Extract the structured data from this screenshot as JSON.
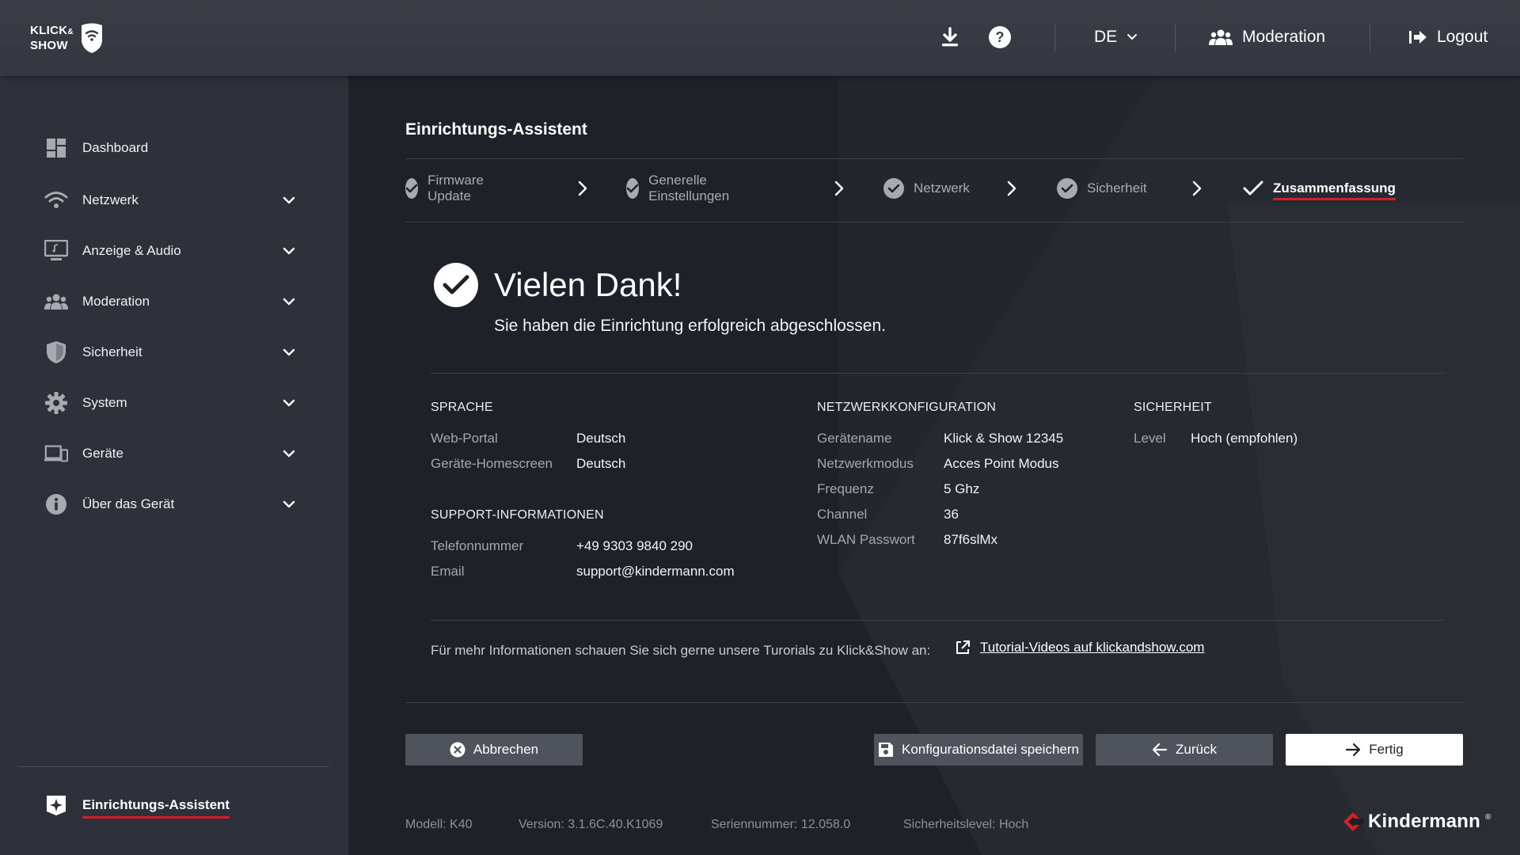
{
  "header": {
    "logo": {
      "line1": "KLICK",
      "amp": "&",
      "line2": "SHOW"
    },
    "download_icon": "download-icon",
    "help_icon": "help-icon",
    "language": "DE",
    "moderation_label": "Moderation",
    "logout_label": "Logout"
  },
  "sidebar": {
    "items": [
      {
        "label": "Dashboard",
        "icon": "dashboard-icon",
        "expandable": false
      },
      {
        "label": "Netzwerk",
        "icon": "wifi-icon",
        "expandable": true
      },
      {
        "label": "Anzeige & Audio",
        "icon": "monitor-icon",
        "expandable": true
      },
      {
        "label": "Moderation",
        "icon": "users-icon",
        "expandable": true
      },
      {
        "label": "Sicherheit",
        "icon": "shield-icon",
        "expandable": true
      },
      {
        "label": "System",
        "icon": "gear-icon",
        "expandable": true
      },
      {
        "label": "Geräte",
        "icon": "devices-icon",
        "expandable": true
      },
      {
        "label": "Über das Gerät",
        "icon": "info-icon",
        "expandable": true
      }
    ],
    "wizard_label": "Einrichtungs-Assistent"
  },
  "main": {
    "title": "Einrichtungs-Assistent",
    "steps": [
      {
        "label": "Firmware Update",
        "done": true
      },
      {
        "label": "Generelle Einstellungen",
        "done": true
      },
      {
        "label": "Netzwerk",
        "done": true
      },
      {
        "label": "Sicherheit",
        "done": true
      },
      {
        "label": "Zusammenfassung",
        "active": true
      }
    ],
    "thanks_title": "Vielen Dank!",
    "thanks_subtitle": "Sie haben die Einrichtung erfolgreich abgeschlossen.",
    "sprache": {
      "heading": "SPRACHE",
      "rows": [
        {
          "key": "Web-Portal",
          "value": "Deutsch"
        },
        {
          "key": "Geräte-Homescreen",
          "value": "Deutsch"
        }
      ]
    },
    "support": {
      "heading": "SUPPORT-INFORMATIONEN",
      "rows": [
        {
          "key": "Telefonnummer",
          "value": "+49 9303 9840 290"
        },
        {
          "key": "Email",
          "value": "support@kindermann.com"
        }
      ]
    },
    "netzwerk": {
      "heading": "NETZWERKKONFIGURATION",
      "rows": [
        {
          "key": "Gerätename",
          "value": "Klick & Show 12345"
        },
        {
          "key": "Netzwerkmodus",
          "value": "Acces Point Modus"
        },
        {
          "key": "Frequenz",
          "value": "5 Ghz"
        },
        {
          "key": "Channel",
          "value": "36"
        },
        {
          "key": "WLAN Passwort",
          "value": "87f6slMx"
        }
      ]
    },
    "sicherheit": {
      "heading": "SICHERHEIT",
      "rows": [
        {
          "key": "Level",
          "value": "Hoch (empfohlen)"
        }
      ]
    },
    "info_text": "Für mehr Informationen schauen Sie sich gerne unsere Turorials zu Klick&Show an:",
    "tutorial_link": "Tutorial-Videos auf klickandshow.com",
    "buttons": {
      "cancel": "Abbrechen",
      "save_config": "Konfigurationsdatei speichern",
      "back": "Zurück",
      "finish": "Fertig"
    },
    "footer": {
      "model": "Modell: K40",
      "version": "Version: 3.1.6C.40.K1069",
      "serial": "Seriennummer: 12.058.0",
      "security_level": "Sicherheitslevel: Hoch",
      "brand": "Kindermann",
      "brand_reg": "®"
    }
  },
  "colors": {
    "accent_red": "#d81d2a",
    "topbar": "#383b43",
    "sidebar": "#2e3139",
    "main_bg": "#1e2128",
    "button_gray": "#4f535c"
  }
}
